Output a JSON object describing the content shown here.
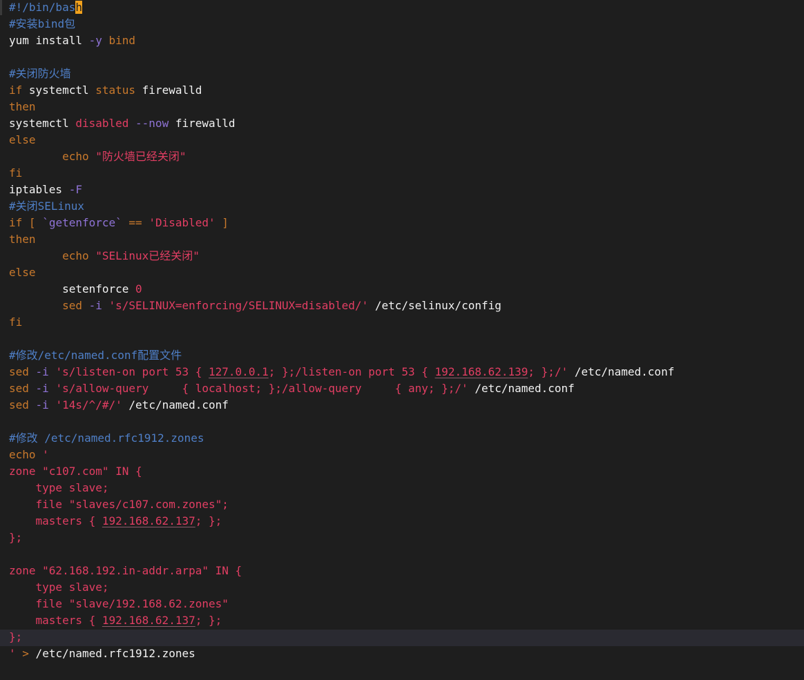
{
  "editor": {
    "colors": {
      "background": "#1e1e1e",
      "default": "#f2f2f2",
      "comment": "#4f7fc7",
      "keyword": "#c9792c",
      "string": "#e23e63",
      "flag": "#8f73d6",
      "cursor": "#f3a21c",
      "current_line": "#2a2a31"
    },
    "lines": [
      [
        {
          "t": "comment",
          "v": "#!/bin/bas"
        },
        {
          "t": "cursor",
          "v": "h"
        }
      ],
      [
        {
          "t": "comment",
          "v": "#安装bind包"
        }
      ],
      [
        {
          "t": "default",
          "v": "yum install "
        },
        {
          "t": "flag",
          "v": "-y"
        },
        {
          "t": "default",
          "v": " "
        },
        {
          "t": "keyword",
          "v": "bind"
        }
      ],
      [],
      [
        {
          "t": "comment",
          "v": "#关闭防火墙"
        }
      ],
      [
        {
          "t": "keyword",
          "v": "if"
        },
        {
          "t": "default",
          "v": " systemctl "
        },
        {
          "t": "keyword",
          "v": "status"
        },
        {
          "t": "default",
          "v": " firewalld"
        }
      ],
      [
        {
          "t": "keyword",
          "v": "then"
        }
      ],
      [
        {
          "t": "default",
          "v": "systemctl "
        },
        {
          "t": "str",
          "v": "disabled"
        },
        {
          "t": "default",
          "v": " "
        },
        {
          "t": "flag",
          "v": "--now"
        },
        {
          "t": "default",
          "v": " firewalld"
        }
      ],
      [
        {
          "t": "keyword",
          "v": "else"
        }
      ],
      [
        {
          "t": "default",
          "v": "        "
        },
        {
          "t": "keyword",
          "v": "echo"
        },
        {
          "t": "default",
          "v": " "
        },
        {
          "t": "str",
          "v": "\"防火墙已经关闭\""
        }
      ],
      [
        {
          "t": "keyword",
          "v": "fi"
        }
      ],
      [
        {
          "t": "default",
          "v": "iptables "
        },
        {
          "t": "flag",
          "v": "-F"
        }
      ],
      [
        {
          "t": "comment",
          "v": "#关闭SELinux"
        }
      ],
      [
        {
          "t": "keyword",
          "v": "if"
        },
        {
          "t": "default",
          "v": " "
        },
        {
          "t": "keyword",
          "v": "["
        },
        {
          "t": "default",
          "v": " "
        },
        {
          "t": "sub",
          "v": "`getenforce`"
        },
        {
          "t": "default",
          "v": " "
        },
        {
          "t": "keyword",
          "v": "=="
        },
        {
          "t": "default",
          "v": " "
        },
        {
          "t": "str",
          "v": "'Disabled'"
        },
        {
          "t": "default",
          "v": " "
        },
        {
          "t": "keyword",
          "v": "]"
        }
      ],
      [
        {
          "t": "keyword",
          "v": "then"
        }
      ],
      [
        {
          "t": "default",
          "v": "        "
        },
        {
          "t": "keyword",
          "v": "echo"
        },
        {
          "t": "default",
          "v": " "
        },
        {
          "t": "str",
          "v": "\"SELinux已经关闭\""
        }
      ],
      [
        {
          "t": "keyword",
          "v": "else"
        }
      ],
      [
        {
          "t": "default",
          "v": "        setenforce "
        },
        {
          "t": "num",
          "v": "0"
        }
      ],
      [
        {
          "t": "default",
          "v": "        "
        },
        {
          "t": "keyword",
          "v": "sed"
        },
        {
          "t": "default",
          "v": " "
        },
        {
          "t": "flag",
          "v": "-i"
        },
        {
          "t": "default",
          "v": " "
        },
        {
          "t": "str",
          "v": "'s/SELINUX=enforcing/SELINUX=disabled/'"
        },
        {
          "t": "default",
          "v": " /etc/selinux/config"
        }
      ],
      [
        {
          "t": "keyword",
          "v": "fi"
        }
      ],
      [],
      [
        {
          "t": "comment",
          "v": "#修改/etc/named.conf配置文件"
        }
      ],
      [
        {
          "t": "keyword",
          "v": "sed"
        },
        {
          "t": "default",
          "v": " "
        },
        {
          "t": "flag",
          "v": "-i"
        },
        {
          "t": "default",
          "v": " "
        },
        {
          "t": "str",
          "v": "'s/listen-on port 53 { "
        },
        {
          "t": "str_u",
          "v": "127.0.0.1"
        },
        {
          "t": "str",
          "v": "; };/listen-on port 53 { "
        },
        {
          "t": "str_u",
          "v": "192.168.62.139"
        },
        {
          "t": "str",
          "v": "; };/'"
        },
        {
          "t": "default",
          "v": " /etc/named.conf"
        }
      ],
      [
        {
          "t": "keyword",
          "v": "sed"
        },
        {
          "t": "default",
          "v": " "
        },
        {
          "t": "flag",
          "v": "-i"
        },
        {
          "t": "default",
          "v": " "
        },
        {
          "t": "str",
          "v": "'s/allow-query     { localhost; };/allow-query     { any; };/'"
        },
        {
          "t": "default",
          "v": " /etc/named.conf"
        }
      ],
      [
        {
          "t": "keyword",
          "v": "sed"
        },
        {
          "t": "default",
          "v": " "
        },
        {
          "t": "flag",
          "v": "-i"
        },
        {
          "t": "default",
          "v": " "
        },
        {
          "t": "str",
          "v": "'14s/^/#/'"
        },
        {
          "t": "default",
          "v": " /etc/named.conf"
        }
      ],
      [],
      [
        {
          "t": "comment",
          "v": "#修改 /etc/named.rfc1912.zones"
        }
      ],
      [
        {
          "t": "keyword",
          "v": "echo"
        },
        {
          "t": "default",
          "v": " "
        },
        {
          "t": "str",
          "v": "'"
        }
      ],
      [
        {
          "t": "str",
          "v": "zone \"c107.com\" IN {"
        }
      ],
      [
        {
          "t": "str",
          "v": "    type slave;"
        }
      ],
      [
        {
          "t": "str",
          "v": "    file \"slaves/c107.com.zones\";"
        }
      ],
      [
        {
          "t": "str",
          "v": "    masters { "
        },
        {
          "t": "str_u",
          "v": "192.168.62.137"
        },
        {
          "t": "str",
          "v": "; };"
        }
      ],
      [
        {
          "t": "str",
          "v": "};"
        }
      ],
      [],
      [
        {
          "t": "str",
          "v": "zone \"62.168.192.in-addr.arpa\" IN {"
        }
      ],
      [
        {
          "t": "str",
          "v": "    type slave;"
        }
      ],
      [
        {
          "t": "str",
          "v": "    file \"slave/192.168.62.zones\""
        }
      ],
      [
        {
          "t": "str",
          "v": "    masters { "
        },
        {
          "t": "str_u",
          "v": "192.168.62.137"
        },
        {
          "t": "str",
          "v": "; };"
        }
      ],
      [
        {
          "t": "str",
          "v": "};"
        }
      ],
      [
        {
          "t": "str",
          "v": "'"
        },
        {
          "t": "default",
          "v": " "
        },
        {
          "t": "keyword",
          "v": ">"
        },
        {
          "t": "default",
          "v": " /etc/named.rfc1912.zones"
        }
      ]
    ],
    "current_line": 38
  }
}
